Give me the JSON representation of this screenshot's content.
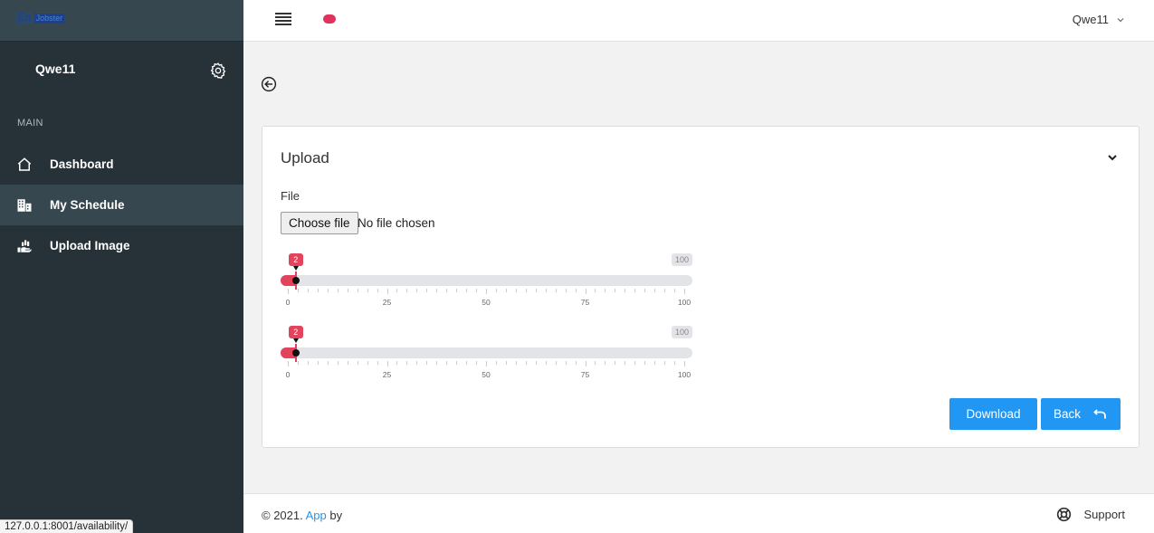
{
  "brand": {
    "mark": "En",
    "word": "Jobster"
  },
  "sidebar": {
    "user_name": "Qwe11",
    "section_header": "MAIN",
    "items": [
      {
        "label": "Dashboard",
        "icon": "home-icon",
        "active": false
      },
      {
        "label": "My Schedule",
        "icon": "building-icon",
        "active": true
      },
      {
        "label": "Upload Image",
        "icon": "upload-hand-icon",
        "active": false
      }
    ]
  },
  "topbar": {
    "user_name": "Qwe11"
  },
  "card": {
    "title": "Upload",
    "file_label": "File",
    "file_button": "Choose file",
    "file_status": "No file chosen",
    "sliders": [
      {
        "value": 2,
        "min": 0,
        "max": 100,
        "max_label": "100",
        "ticks": [
          "0",
          "25",
          "50",
          "75",
          "100"
        ]
      },
      {
        "value": 2,
        "min": 0,
        "max": 100,
        "max_label": "100",
        "ticks": [
          "0",
          "25",
          "50",
          "75",
          "100"
        ]
      }
    ],
    "download_label": "Download",
    "back_label": "Back"
  },
  "footer": {
    "copyright": "© 2021.",
    "app_link": "App",
    "by": "by",
    "support_label": "Support"
  },
  "status_url": "127.0.0.1:8001/availability/",
  "colors": {
    "sidebar": "#263238",
    "accent": "#2196f3",
    "slider": "#e2435d",
    "pill": "#e0325f"
  }
}
